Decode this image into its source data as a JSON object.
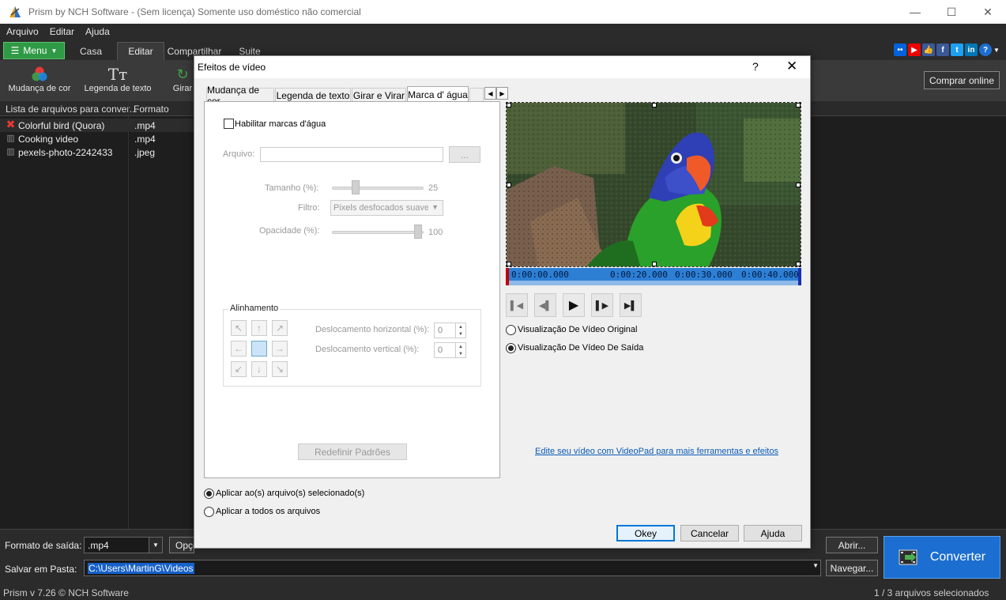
{
  "window": {
    "title": "Prism by NCH Software - (Sem licença) Somente uso doméstico não comercial"
  },
  "menubar": [
    "Arquivo",
    "Editar",
    "Ajuda"
  ],
  "ribbon": {
    "menu_label": "Menu",
    "tabs": [
      "Casa",
      "Editar",
      "Compartilhar",
      "Suite"
    ],
    "active_tab": "Editar"
  },
  "toolbar": {
    "tools": [
      "Mudança de cor",
      "Legenda de texto",
      "Girar"
    ],
    "buy_label": "Comprar online"
  },
  "filelist": {
    "headers": [
      "Lista de arquivos para conver...",
      "Formato"
    ],
    "rows": [
      {
        "name": "Colorful bird (Quora)",
        "format": ".mp4"
      },
      {
        "name": "Cooking video",
        "format": ".mp4"
      },
      {
        "name": "pexels-photo-2242433",
        "format": ".jpeg"
      }
    ]
  },
  "bottom": {
    "output_format_label": "Formato de saída:",
    "output_format_value": ".mp4",
    "options_label": "Opçõ",
    "open_label": "Abrir...",
    "save_folder_label": "Salvar em Pasta:",
    "save_folder_value": "C:\\Users\\MartinG\\Videos",
    "browse_label": "Navegar...",
    "convert_label": "Converter"
  },
  "status": {
    "left": "Prism v 7.26 © NCH Software",
    "right": "1 / 3 arquivos selecionados"
  },
  "dialog": {
    "title": "Efeitos de vídeo",
    "help": "?",
    "tabs": [
      "Mudança de cor",
      "Legenda de texto",
      "Girar e Virar",
      "Marca d' água"
    ],
    "active_tab": "Marca d' água",
    "enable_watermark": "Habilitar marcas d'água",
    "file_label": "Arquivo:",
    "browse_label": "...",
    "size_label": "Tamanho (%):",
    "size_value": "25",
    "filter_label": "Filtro:",
    "filter_value": "Pixels desfocados suaves",
    "opacity_label": "Opacidade (%):",
    "opacity_value": "100",
    "alignment_label": "Alinhamento",
    "h_offset_label": "Deslocamento horizontal (%):",
    "h_offset_value": "0",
    "v_offset_label": "Deslocamento vertical (%):",
    "v_offset_value": "0",
    "reset_label": "Redefinir Padrões",
    "timeline": [
      "0:00:00.000",
      "0:00:20.000",
      "0:00:30.000",
      "0:00:40.000"
    ],
    "preview_original": "Visualização De Vídeo Original",
    "preview_output": "Visualização De Vídeo De Saída",
    "apply_selected": "Aplicar ao(s) arquivo(s) selecionado(s)",
    "apply_all": "Aplicar a todos os arquivos",
    "videopad_link": "Edite seu vídeo com VideoPad para mais ferramentas e efeitos",
    "ok_label": "Okey",
    "cancel_label": "Cancelar",
    "help_label": "Ajuda"
  }
}
